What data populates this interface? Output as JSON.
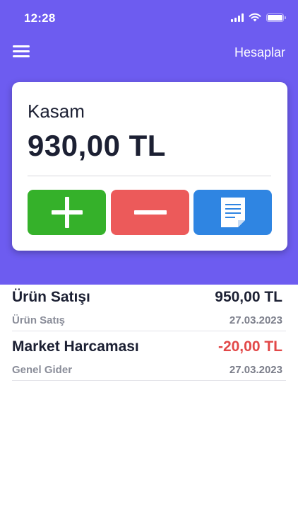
{
  "status_bar": {
    "time": "12:28"
  },
  "nav": {
    "accounts_label": "Hesaplar"
  },
  "icons": {
    "menu": "hamburger-menu-icon",
    "add": "plus-icon",
    "subtract": "minus-icon",
    "report": "document-icon"
  },
  "colors": {
    "header": "#6d5cf0",
    "add_button": "#35b12a",
    "subtract_button": "#ec5a5a",
    "report_button": "#2f85e2",
    "negative_amount": "#e24848"
  },
  "account_card": {
    "title": "Kasam",
    "balance": "930,00 TL"
  },
  "transactions": [
    {
      "title": "Ürün Satışı",
      "amount": "950,00 TL",
      "category": "Ürün Satış",
      "date": "27.03.2023",
      "negative": false
    },
    {
      "title": "Market Harcaması",
      "amount": "-20,00 TL",
      "category": "Genel Gider",
      "date": "27.03.2023",
      "negative": true
    }
  ]
}
